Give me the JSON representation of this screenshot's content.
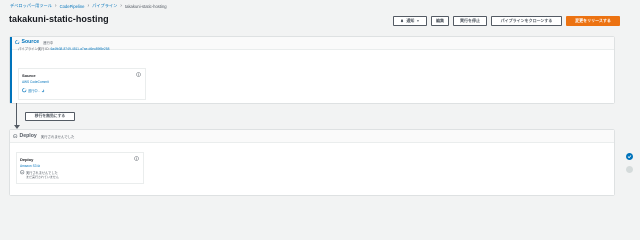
{
  "breadcrumb": {
    "items": [
      "デベロッパー用ツール",
      "CodePipeline",
      "パイプライン"
    ],
    "current": "takakuni-static-hosting"
  },
  "page_title": "takakuni-static-hosting",
  "header_buttons": {
    "notify": "通知",
    "edit": "編集",
    "stop": "実行を停止",
    "clone": "パイプラインをクローンする",
    "release": "変更をリリースする"
  },
  "stages": {
    "source": {
      "name": "Source",
      "status": "進行中",
      "exec_label": "パイプライン実行 ID:",
      "exec_id": "6a4fb38-8749-4511-a7ae-d6ec89f8e258",
      "action": {
        "name": "Source",
        "provider": "AWS CodeCommit",
        "status": "進行中 -"
      }
    },
    "transition_button": "移行を無効にする",
    "deploy": {
      "name": "Deploy",
      "status": "実行されませんでした",
      "action": {
        "name": "Deploy",
        "provider": "Amazon S3",
        "status": "実行されませんでした",
        "sub": "まだ実行されていません"
      }
    }
  },
  "colors": {
    "accent": "#0073bb",
    "primary_button": "#ec7211",
    "background": "#f2f3f3"
  },
  "icons": [
    "bell-icon",
    "info-icon",
    "external-link-icon",
    "status-ring-icon",
    "check-icon"
  ]
}
